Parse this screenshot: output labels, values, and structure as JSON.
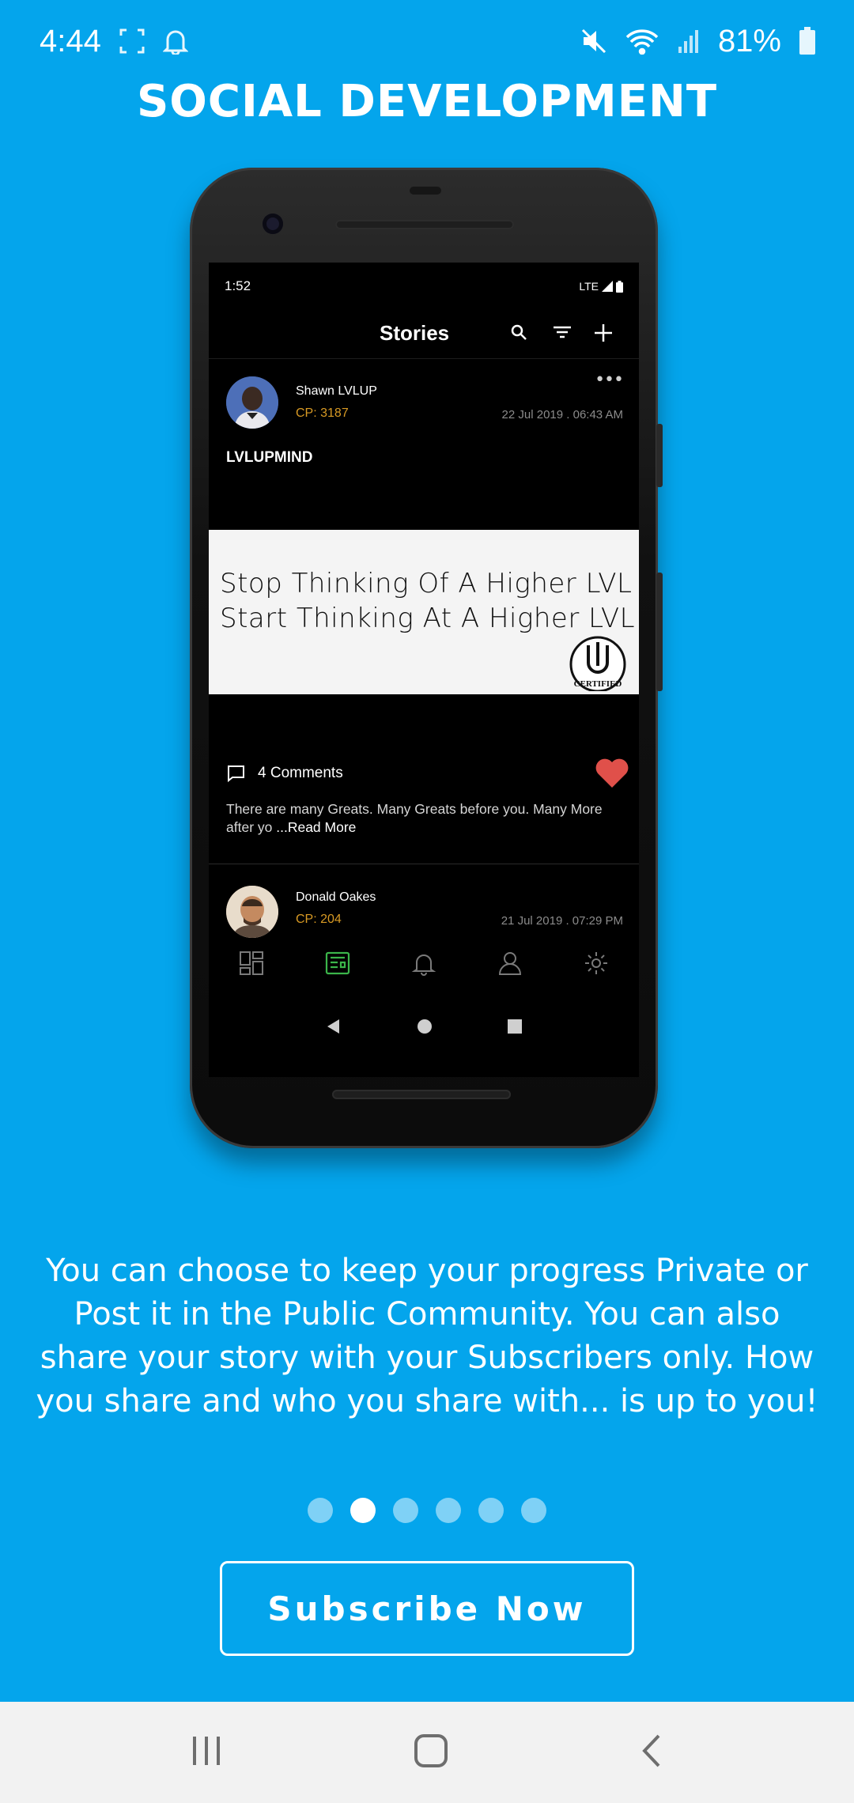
{
  "status_bar": {
    "time": "4:44",
    "battery": "81%",
    "icons": [
      "screenshot-icon",
      "notification-bell-icon",
      "mute-icon",
      "wifi-icon",
      "signal-icon",
      "battery-icon"
    ]
  },
  "page": {
    "title": "SOCIAL DEVELOPMENT",
    "description": "You can choose to keep your progress Private or Post it in the Public Community. You can also share your story with your Subscribers only. How you share and who you share with... is up to you!",
    "subscribe_label": "Subscribe Now",
    "pager": {
      "count": 6,
      "active_index": 1
    }
  },
  "mockup": {
    "status_time": "1:52",
    "status_network": "LTE",
    "header_title": "Stories",
    "post1": {
      "author": "Shawn LVLUP",
      "cp": "CP: 3187",
      "date": "22 Jul 2019 . 06:43 AM",
      "headline": "LVLUPMIND",
      "image_line1": "Stop Thinking Of A Higher LVL",
      "image_line2": "Start Thinking At A Higher LVL",
      "seal_text": "CERTIFIED",
      "comments": "4 Comments",
      "text": "There are many Greats. Many Greats before you. Many More after yo",
      "read_more": " ...Read More"
    },
    "post2": {
      "author": "Donald Oakes",
      "cp": "CP: 204",
      "date": "21 Jul 2019 . 07:29 PM"
    }
  },
  "colors": {
    "background": "#04a5ec",
    "accent_gold": "#d89a24",
    "heart": "#e0504a",
    "active_tab": "#3bb54a"
  }
}
